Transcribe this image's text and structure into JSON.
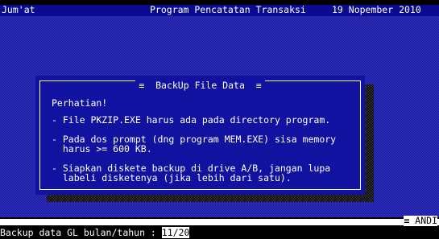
{
  "header": {
    "day": "Jum'at",
    "app_title": "Program Pencatatan Transaksi",
    "date": "19 Nopember 2010"
  },
  "dialog": {
    "title": "≡  BackUp File Data  ≡",
    "heading": "Perhatian!",
    "items": [
      {
        "line1": "- File PKZIP.EXE harus ada pada directory program.",
        "line2": ""
      },
      {
        "line1": "- Pada dos prompt (dng program MEM.EXE) sisa memory",
        "line2": "  harus >= 600 KB."
      },
      {
        "line1": "- Siapkan diskete backup di drive A/B, jangan lupa",
        "line2": "  labeli disketenya (jika lebih dari satu)."
      }
    ]
  },
  "user_indicator": "≡ ANDI",
  "status": {
    "prompt": "Backup data GL bulan/tahun : ",
    "input_value": "11/20"
  },
  "colors": {
    "screen_blue": "#1a1aa8",
    "dialog_blue": "#1212a0",
    "header_blue": "#0a0a90"
  }
}
